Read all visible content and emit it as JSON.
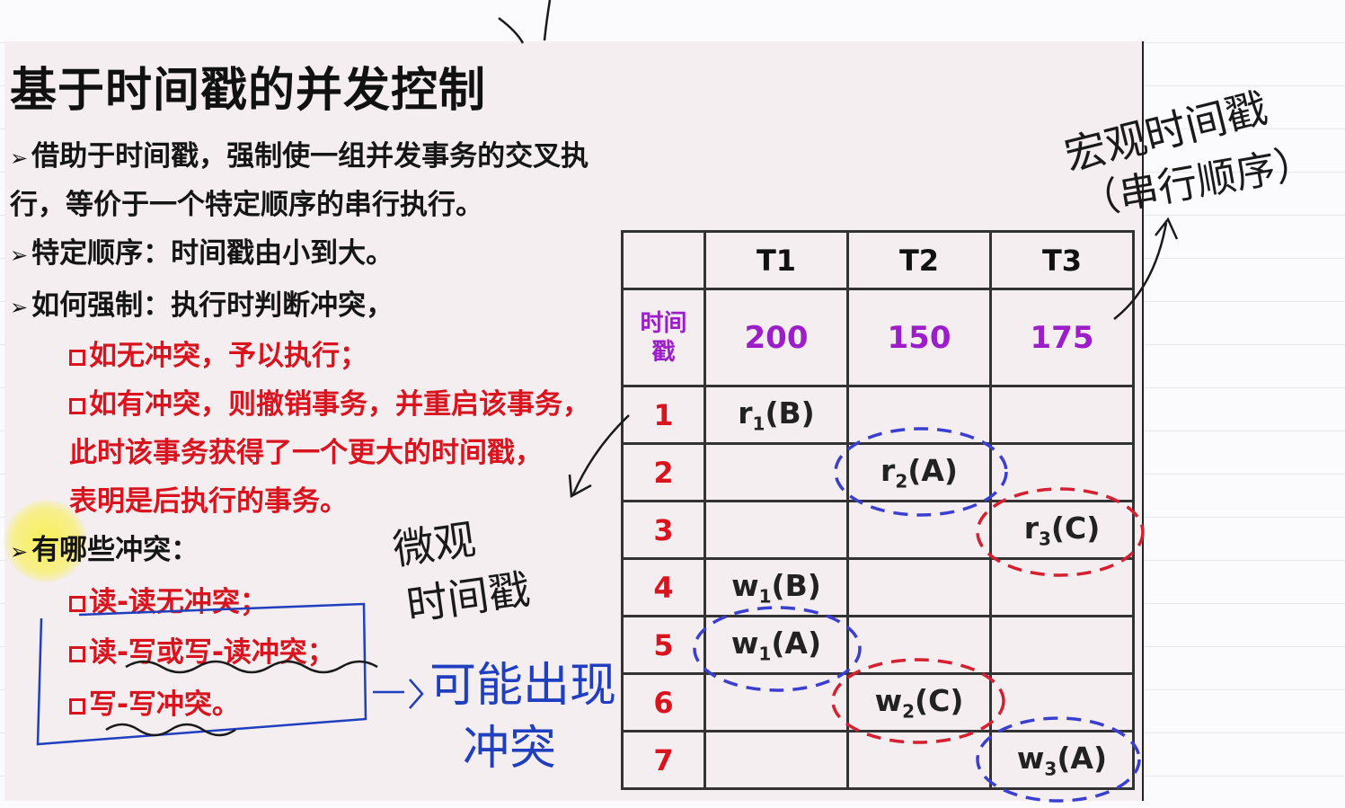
{
  "slide": {
    "title": "基于时间戳的并发控制",
    "bullets": [
      "借助于时间戳，强制使一组并发事务的交叉执",
      "行，等价于一个特定顺序的串行执行。",
      "特定顺序：时间戳由小到大。",
      "如何强制：执行时判断冲突，"
    ],
    "sub_red": [
      "如无冲突，予以执行；",
      "如有冲突，则撤销事务，并重启该事务，",
      "此时该事务获得了一个更大的时间戳，",
      "表明是后执行的事务。"
    ],
    "conflict_head": "有哪些冲突：",
    "conflicts": [
      "读-读无冲突；",
      "读-写或写-读冲突；",
      "写-写冲突。"
    ]
  },
  "table": {
    "headers": [
      "T1",
      "T2",
      "T3"
    ],
    "ts_label": "时间戳",
    "ts_label_lines": [
      "时间",
      "戳"
    ],
    "timestamps": [
      "200",
      "150",
      "175"
    ],
    "rows": [
      {
        "num": "1",
        "cells": [
          {
            "op": "r",
            "sub": "1",
            "arg": "(B)"
          },
          null,
          null
        ]
      },
      {
        "num": "2",
        "cells": [
          null,
          {
            "op": "r",
            "sub": "2",
            "arg": "(A)"
          },
          null
        ]
      },
      {
        "num": "3",
        "cells": [
          null,
          null,
          {
            "op": "r",
            "sub": "3",
            "arg": "(C)"
          }
        ]
      },
      {
        "num": "4",
        "cells": [
          {
            "op": "w",
            "sub": "1",
            "arg": "(B)"
          },
          null,
          null
        ]
      },
      {
        "num": "5",
        "cells": [
          {
            "op": "w",
            "sub": "1",
            "arg": "(A)"
          },
          null,
          null
        ]
      },
      {
        "num": "6",
        "cells": [
          null,
          {
            "op": "w",
            "sub": "2",
            "arg": "(C)"
          },
          null
        ]
      },
      {
        "num": "7",
        "cells": [
          null,
          null,
          {
            "op": "w",
            "sub": "3",
            "arg": "(A)"
          }
        ]
      }
    ]
  },
  "handwriting": {
    "macro_line1": "宏观时间戳",
    "macro_line2": "（串行顺序）",
    "micro_line1": "微观",
    "micro_line2": "时间戳",
    "possible_line1": "可能出现",
    "possible_line2": "冲突"
  },
  "colors": {
    "red": "#d9141e",
    "purple": "#9b1ec8",
    "blue_dash": "#3a3fd0",
    "red_dash": "#d42030",
    "ink": "#1a1a1a",
    "pen_blue": "#1f3fbf"
  }
}
